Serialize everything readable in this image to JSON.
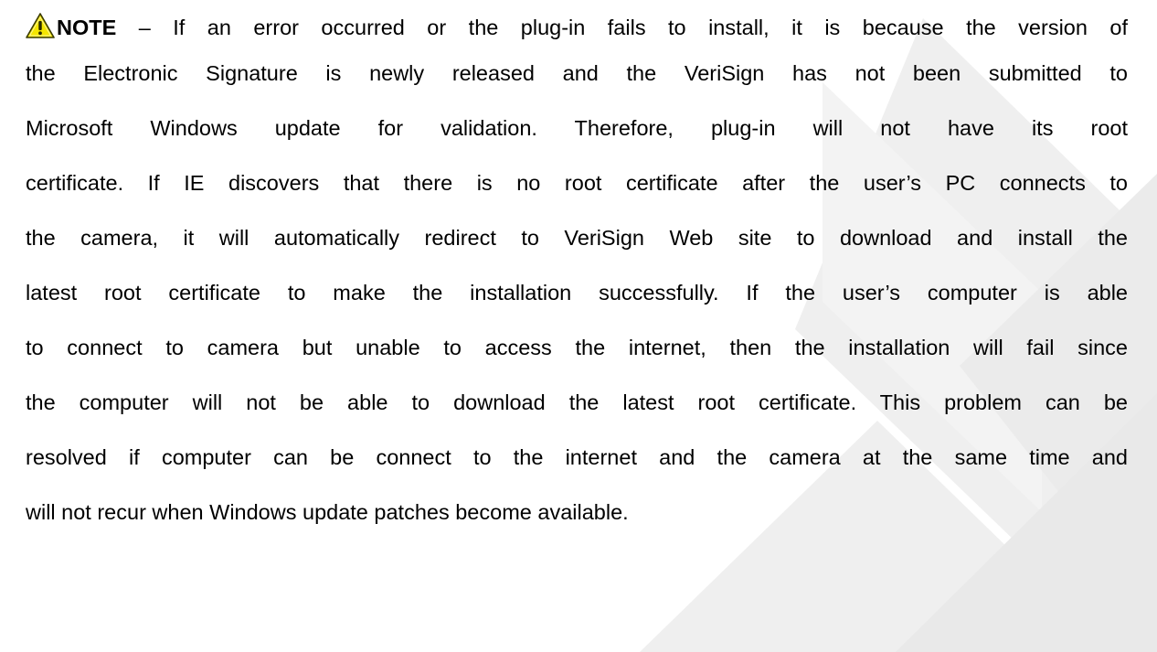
{
  "note": {
    "icon": "warning-icon",
    "label": "NOTE",
    "lines": [
      " – If an error occurred or the plug-in fails to install, it is because the version of",
      "the Electronic Signature is newly released and the VeriSign has not been submitted to",
      "Microsoft Windows update for validation. Therefore, plug-in will not have its root",
      "certificate. If IE discovers that there is no root certificate after the user’s PC connects to",
      "the camera, it will automatically redirect to VeriSign Web site to download and install the",
      "latest root certificate to make the installation successfully. If the user’s computer is able",
      "to connect to camera but unable to access the internet, then the installation will fail since",
      "the computer will not be able to download the latest root certificate. This problem can be",
      "resolved if computer can be connect to the internet and the camera at the same time and",
      "will not recur when Windows update patches become available."
    ]
  },
  "colors": {
    "text": "#000000",
    "background": "#ffffff",
    "watermark": "#ececec",
    "icon_fill": "#f5e600",
    "icon_border": "#3a3a00"
  }
}
